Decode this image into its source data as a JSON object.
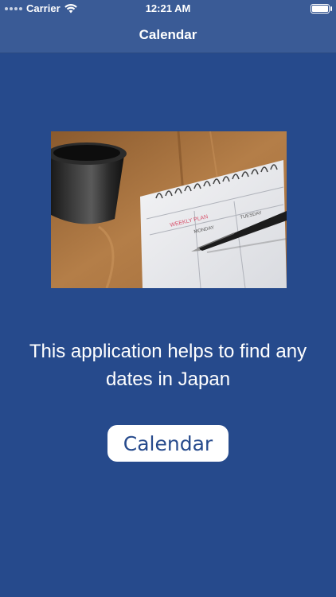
{
  "status_bar": {
    "carrier": "Carrier",
    "time": "12:21 AM",
    "icons": [
      "signal-dots-icon",
      "wifi-icon",
      "battery-icon"
    ]
  },
  "nav_bar": {
    "title": "Calendar"
  },
  "hero_image": {
    "subject": "coffee mug, spiral weekly planner notebook and pen on wooden table",
    "notebook_text": {
      "plan": "WEEKLY PLAN",
      "monday": "MONDAY",
      "tuesday": "TUESDAY"
    }
  },
  "main": {
    "description": "This application helps to find any dates in Japan",
    "button_label": "Calendar"
  },
  "colors": {
    "background": "#264a8c",
    "nav_bar": "#3a5b96",
    "button_bg": "#ffffff",
    "button_text": "#264a8c"
  }
}
